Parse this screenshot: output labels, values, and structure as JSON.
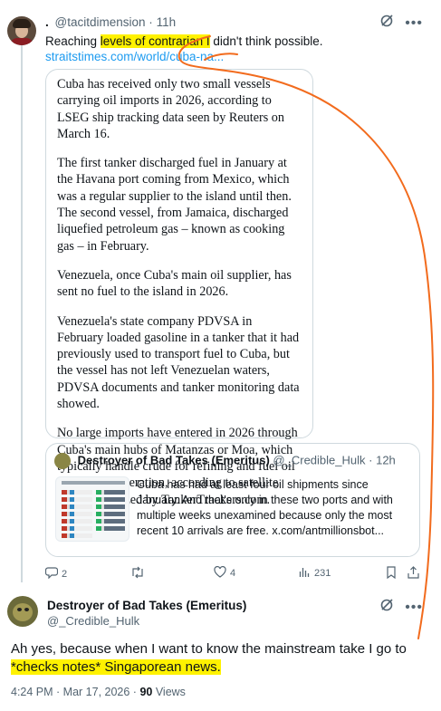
{
  "post": {
    "display_name": ".",
    "handle": "@tacitdimension",
    "separator": "·",
    "time": "11h",
    "text_before": "Reaching ",
    "text_highlight": "levels of contrarian I",
    "text_after": " didn't think possible.",
    "link": "straitstimes.com/world/cuba-na..."
  },
  "article": {
    "paragraphs": [
      "Cuba has received only two small vessels carrying oil imports in 2026, according to LSEG ship tracking data seen by Reuters on March 16.",
      "The first tanker discharged fuel in January at the Havana port coming from Mexico, which was a regular supplier to the island until then. The second vessel, from Jamaica, discharged liquefied petroleum gas – known as cooking gas – in February.",
      "Venezuela, once Cuba's main oil supplier, has sent no fuel to the island in 2026.",
      "Venezuela's state company PDVSA in February loaded gasoline in a tanker that it had previously used to transport fuel to Cuba, but the vessel has not left Venezuelan waters, PDVSA documents and tanker monitoring data showed.",
      "No large imports have entered in 2026 through Cuba's main hubs of Matanzas or Moa, which typically handle crude for refining and fuel oil for power generation, according to satellite images analyzed by TankerTrackers.com."
    ]
  },
  "quote": {
    "name": "Destroyer of Bad Takes (Emeritus)",
    "handle": "@_Credible_Hulk",
    "separator": "·",
    "time": "12h",
    "text": "Cuba has had at least four oil shipments since January. And that's only in these two ports and with multiple weeks unexamined because only the most recent 10 arrivals are free.  x.com/antmillionsbot..."
  },
  "actions": {
    "replies": "2",
    "reposts": "",
    "likes": "4",
    "views": "231"
  },
  "reply": {
    "name": "Destroyer of Bad Takes (Emeritus)",
    "handle": "@_Credible_Hulk",
    "text_before": "Ah yes, because when I want to know the mainstream take I go to ",
    "text_highlight": "*checks notes* Singaporean news.",
    "meta_time": "4:24 PM · Mar 17, 2026 · ",
    "views_count": "90",
    "views_label": " Views"
  },
  "icons": {
    "grok": "grok-icon",
    "more": "more-icon",
    "reply": "reply-icon",
    "repost": "repost-icon",
    "like": "heart-icon",
    "views": "views-icon",
    "bookmark": "bookmark-icon",
    "share": "share-icon"
  },
  "colors": {
    "highlight": "#fff200",
    "link": "#1d9bf0",
    "annotation": "#f26b1d",
    "muted": "#536471"
  }
}
